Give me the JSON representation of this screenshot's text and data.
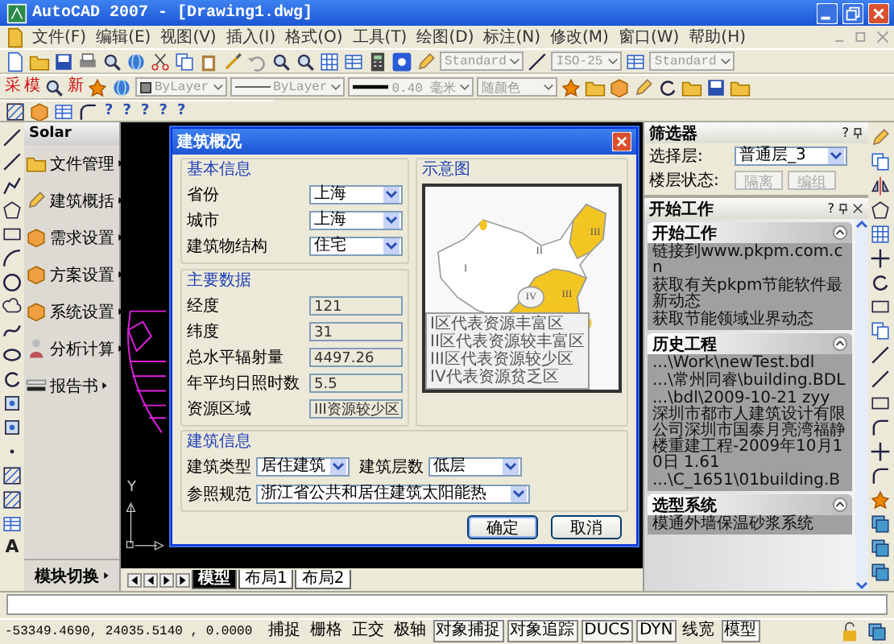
{
  "window": {
    "title": "AutoCAD 2007 - [Drawing1.dwg]"
  },
  "menu": [
    "文件(F)",
    "编辑(E)",
    "视图(V)",
    "插入(I)",
    "格式(O)",
    "工具(T)",
    "绘图(D)",
    "标注(N)",
    "修改(M)",
    "窗口(W)",
    "帮助(H)"
  ],
  "toolbar_1": {
    "dropdowns": [
      {
        "value": "Standard",
        "disabled": true
      },
      {
        "value": "ISO-25",
        "disabled": true
      },
      {
        "value": "Standard",
        "disabled": true
      }
    ]
  },
  "toolbar_2": {
    "glyph_buttons": [
      "采",
      "模",
      "新"
    ],
    "dropdowns": [
      {
        "kind": "color",
        "value": "ByLayer",
        "disabled": true
      },
      {
        "kind": "linetype",
        "value": "ByLayer",
        "disabled": true
      },
      {
        "kind": "lineweight",
        "value": "0.40 毫米",
        "disabled": true
      },
      {
        "kind": "plain",
        "value": "随颜色",
        "disabled": true
      }
    ]
  },
  "toolbar_3": {
    "glyph_buttons": [
      "?",
      "?",
      "?",
      "?",
      "?"
    ]
  },
  "left_toolbar": {
    "text_button": "A"
  },
  "solar_panel": {
    "title": "Solar",
    "items": [
      "文件管理",
      "建筑概括",
      "需求设置",
      "方案设置",
      "系统设置",
      "分析计算",
      "报告书"
    ],
    "footer": "模块切换"
  },
  "canvas": {
    "ucs_y_label": "Y",
    "layout_tabs": [
      {
        "label": "模型",
        "selected": true
      },
      {
        "label": "布局1",
        "selected": false
      },
      {
        "label": "布局2",
        "selected": false
      }
    ]
  },
  "dialog": {
    "title": "建筑概况",
    "basic": {
      "title": "基本信息",
      "fields": [
        {
          "label": "省份",
          "value": "上海"
        },
        {
          "label": "城市",
          "value": "上海"
        },
        {
          "label": "建筑物结构",
          "value": "住宅"
        }
      ]
    },
    "main_data": {
      "title": "主要数据",
      "fields": [
        {
          "label": "经度",
          "value": "121"
        },
        {
          "label": "纬度",
          "value": "31"
        },
        {
          "label": "总水平辐射量",
          "value": "4497.26"
        },
        {
          "label": "年平均日照时数",
          "value": "5.5"
        },
        {
          "label": "资源区域",
          "value": "III资源较少区"
        }
      ]
    },
    "map": {
      "title": "示意图",
      "zone_labels": [
        "III",
        "II",
        "I",
        "IV",
        "III"
      ],
      "legend": [
        "I区代表资源丰富区",
        "II区代表资源较丰富区",
        "III区代表资源较少区",
        "IV代表资源贫乏区"
      ]
    },
    "building": {
      "title": "建筑信息",
      "fields": [
        {
          "label": "建筑类型",
          "value": "居住建筑"
        },
        {
          "label": "建筑层数",
          "value": "低层"
        },
        {
          "label": "参照规范",
          "value": "浙江省公共和居住建筑太阳能热"
        }
      ]
    },
    "buttons": [
      "确定",
      "取消"
    ]
  },
  "filter_panel": {
    "title": "筛选器",
    "help_glyph": "?",
    "layer": {
      "label": "选择层:",
      "value": "普通层_3"
    },
    "floor_state": {
      "label": "楼层状态:",
      "buttons": [
        {
          "label": "隔离",
          "disabled": true
        },
        {
          "label": "编组",
          "disabled": true
        }
      ]
    }
  },
  "start_panel": {
    "title": "开始工作",
    "help_glyph": "?",
    "sections": [
      {
        "title": "开始工作",
        "expanded": true,
        "items": [
          "链接到www.pkpm.com.cn",
          "获取有关pkpm节能软件最新动态",
          "获取节能领域业界动态"
        ]
      },
      {
        "title": "历史工程",
        "expanded": true,
        "items": [
          "...\\Work\\newTest.bdl",
          "...\\常州同睿\\building.BDL",
          "...\\bdl\\2009-10-21 zyy 深圳市都市人建筑设计有限公司深圳市国泰月亮湾福静楼重建工程-2009年10月10日 1.61",
          "...\\C_1651\\01building.B"
        ]
      },
      {
        "title": "选型系统",
        "expanded": true,
        "items": [
          "模通外墙保温砂浆系统"
        ]
      }
    ]
  },
  "status_bar": {
    "coordinates": "-53349.4690, 24035.5140 , 0.0000",
    "toggles": [
      {
        "label": "捕捉",
        "on": false
      },
      {
        "label": "栅格",
        "on": false
      },
      {
        "label": "正交",
        "on": false
      },
      {
        "label": "极轴",
        "on": false
      },
      {
        "label": "对象捕捉",
        "on": true
      },
      {
        "label": "对象追踪",
        "on": true
      },
      {
        "label": "DUCS",
        "on": true
      },
      {
        "label": "DYN",
        "on": true
      },
      {
        "label": "线宽",
        "on": false
      },
      {
        "label": "模型",
        "on": true
      }
    ]
  }
}
